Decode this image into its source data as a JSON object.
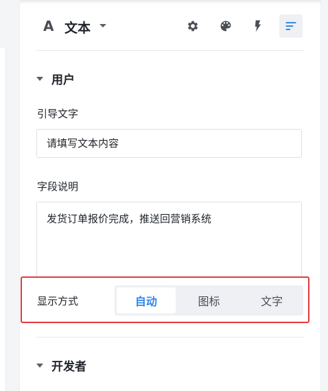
{
  "header": {
    "type_icon": "A",
    "type_label": "文本",
    "icons": [
      "gear-icon",
      "palette-icon",
      "lightning-icon",
      "sort-lines-icon"
    ]
  },
  "sections": {
    "user_title": "用户",
    "developer_title": "开发者"
  },
  "fields": {
    "placeholder_label": "引导文字",
    "placeholder_value": "请填写文本内容",
    "description_label": "字段说明",
    "description_value": "发货订单报价完成，推送回营销系统"
  },
  "display": {
    "label": "显示方式",
    "options": [
      "自动",
      "图标",
      "文字"
    ],
    "selected": "自动"
  },
  "colors": {
    "accent": "#2f86e8",
    "highlight": "#e0393e"
  }
}
